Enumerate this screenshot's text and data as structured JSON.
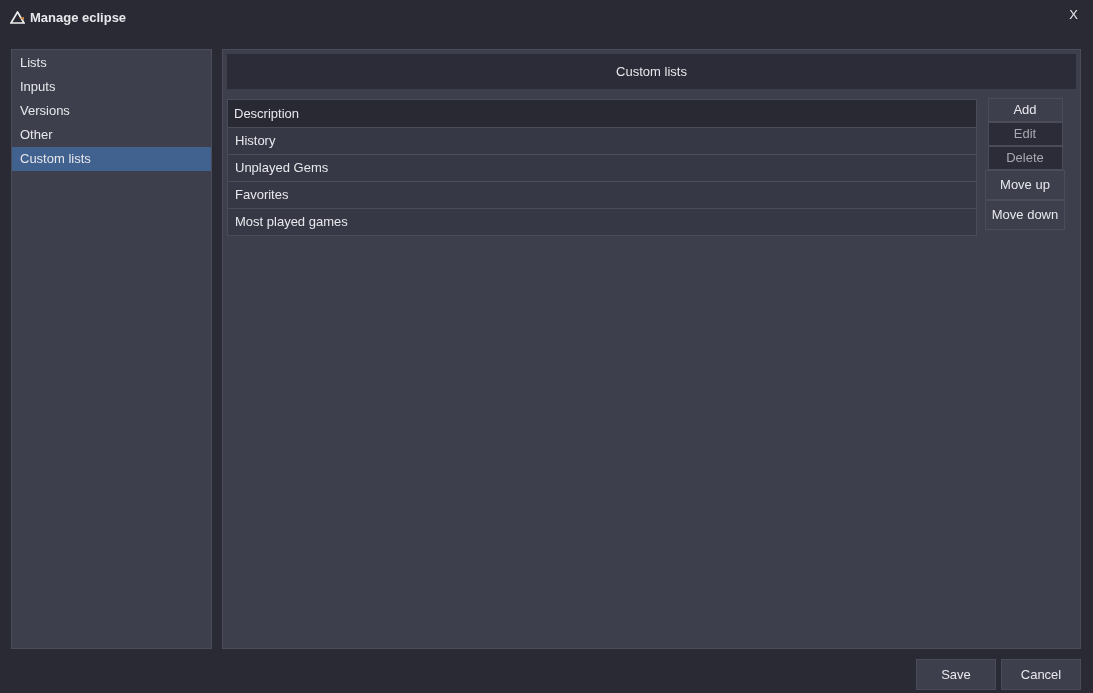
{
  "window": {
    "title": "Manage eclipse",
    "close": "X"
  },
  "sidebar": {
    "items": [
      {
        "label": "Lists",
        "selected": false
      },
      {
        "label": "Inputs",
        "selected": false
      },
      {
        "label": "Versions",
        "selected": false
      },
      {
        "label": "Other",
        "selected": false
      },
      {
        "label": "Custom lists",
        "selected": true
      }
    ]
  },
  "panel": {
    "title": "Custom lists",
    "table": {
      "columns": [
        "Description"
      ],
      "rows": [
        "History",
        "Unplayed Gems",
        "Favorites",
        "Most played games"
      ]
    },
    "buttons": [
      {
        "label": "Add",
        "disabled": false
      },
      {
        "label": "Edit",
        "disabled": true
      },
      {
        "label": "Delete",
        "disabled": true
      },
      {
        "label": "Move up",
        "disabled": false
      },
      {
        "label": "Move down",
        "disabled": false
      }
    ]
  },
  "footer": {
    "buttons": [
      "Save",
      "Cancel"
    ]
  }
}
